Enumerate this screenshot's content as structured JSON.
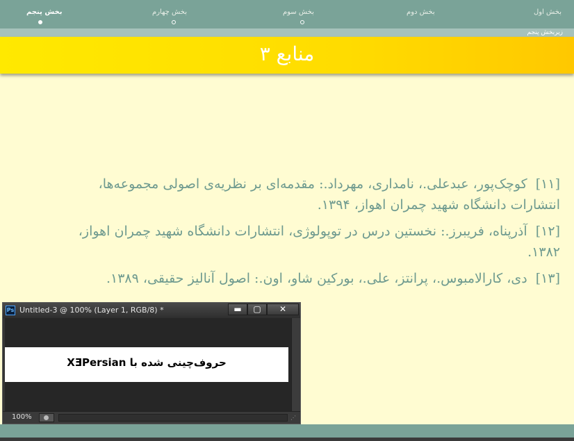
{
  "nav": {
    "sections": [
      {
        "label": "بخش پنجم",
        "active": true
      },
      {
        "label": "بخش چهارم",
        "active": false
      },
      {
        "label": "بخش سوم",
        "active": false
      },
      {
        "label": "بخش دوم",
        "active": false
      },
      {
        "label": "بخش اول",
        "active": false
      }
    ],
    "subsection": "زیربخش پنجم"
  },
  "slide": {
    "title": "منابع ۳",
    "references": [
      {
        "num": "[۱۱]",
        "text": "کوچک‌پور، عبدعلی.، نامداری، مهرداد.: مقدمه‌ای بر نظریه‌ی اصولی مجموعه‌ها، انتشارات دانشگاه شهید چمران اهواز، ۱۳۹۴."
      },
      {
        "num": "[۱۲]",
        "text": "آذرپناه، فریبرز.: نخستین درس در توپولوژی، انتشارات دانشگاه شهید چمران اهواز، ۱۳۸۲."
      },
      {
        "num": "[۱۳]",
        "text": "دی، کارالامبوس.، پرانتز، علی.، بورکین شاو، اون.: اصول آنالیز حقیقی، ۱۳۸۹."
      }
    ]
  },
  "photoshop": {
    "app_icon": "Ps",
    "window_title": "Untitled-3 @ 100% (Layer 1, RGB/8) *",
    "minimize": "▬",
    "maximize": "▢",
    "close": "✕",
    "canvas_text": "حروف‌چینی شده با XƎPersian",
    "zoom": "100%"
  }
}
